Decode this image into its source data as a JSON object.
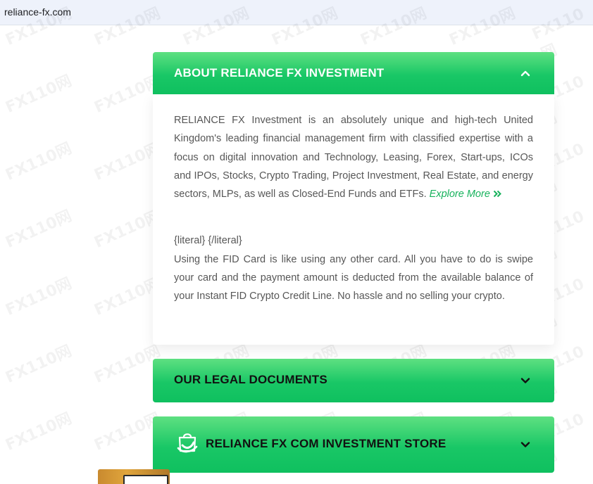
{
  "browser": {
    "url": "reliance-fx.com"
  },
  "watermark": "FX110网",
  "about": {
    "title": "ABOUT RELIANCE FX INVESTMENT",
    "paragraph": "RELIANCE FX Investment is an absolutely unique and high-tech United Kingdom's leading financial management firm with classified expertise with a focus on digital innovation and Technology, Leasing, Forex, Start-ups, ICOs and IPOs, Stocks, Crypto Trading, Project Investment, Real Estate, and energy sectors, MLPs, as well as Closed-End Funds and ETFs.",
    "explore_label": "Explore More",
    "literal": "{literal} {/literal}",
    "fid_text": "Using the FID Card is like using any other card. All you have to do is swipe your card and the payment amount is deducted from the available balance of your Instant FID Crypto Credit Line. No hassle and no selling your crypto.",
    "expanded": true
  },
  "legal": {
    "title": "OUR LEGAL DOCUMENTS",
    "expanded": false
  },
  "store": {
    "title": "RELIANCE FX COM INVESTMENT STORE",
    "expanded": false
  },
  "colors": {
    "accent_green": "#19c766",
    "link_green": "#17b25c"
  }
}
